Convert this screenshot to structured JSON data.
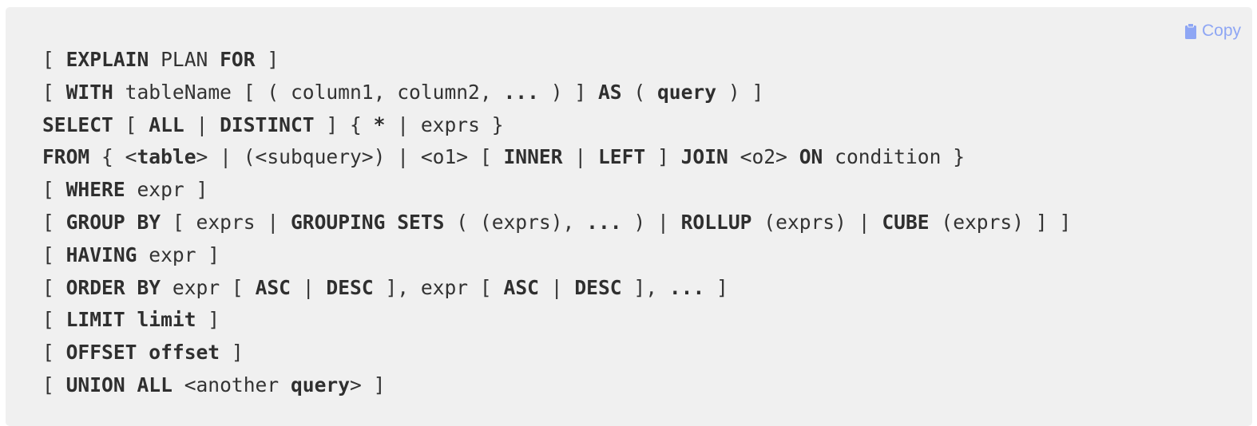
{
  "copy_button": {
    "label": "Copy",
    "icon": "clipboard-icon",
    "color": "#8ea6f4"
  },
  "code_lines": [
    [
      {
        "t": "[ ",
        "b": false
      },
      {
        "t": "EXPLAIN",
        "b": true
      },
      {
        "t": " PLAN ",
        "b": false
      },
      {
        "t": "FOR",
        "b": true
      },
      {
        "t": " ]",
        "b": false
      }
    ],
    [
      {
        "t": "[ ",
        "b": false
      },
      {
        "t": "WITH",
        "b": true
      },
      {
        "t": " tableName [ ( column1, column2, ",
        "b": false
      },
      {
        "t": "...",
        "b": true
      },
      {
        "t": " ) ] ",
        "b": false
      },
      {
        "t": "AS",
        "b": true
      },
      {
        "t": " ( ",
        "b": false
      },
      {
        "t": "query",
        "b": true
      },
      {
        "t": " ) ]",
        "b": false
      }
    ],
    [
      {
        "t": "SELECT",
        "b": true
      },
      {
        "t": " [ ",
        "b": false
      },
      {
        "t": "ALL",
        "b": true
      },
      {
        "t": " | ",
        "b": false
      },
      {
        "t": "DISTINCT",
        "b": true
      },
      {
        "t": " ] { ",
        "b": false
      },
      {
        "t": "*",
        "b": true
      },
      {
        "t": " | exprs }",
        "b": false
      }
    ],
    [
      {
        "t": "FROM",
        "b": true
      },
      {
        "t": " { <",
        "b": false
      },
      {
        "t": "table",
        "b": true
      },
      {
        "t": "> | (<subquery>) | <o1> [ ",
        "b": false
      },
      {
        "t": "INNER",
        "b": true
      },
      {
        "t": " | ",
        "b": false
      },
      {
        "t": "LEFT",
        "b": true
      },
      {
        "t": " ] ",
        "b": false
      },
      {
        "t": "JOIN",
        "b": true
      },
      {
        "t": " <o2> ",
        "b": false
      },
      {
        "t": "ON",
        "b": true
      },
      {
        "t": " condition }",
        "b": false
      }
    ],
    [
      {
        "t": "[ ",
        "b": false
      },
      {
        "t": "WHERE",
        "b": true
      },
      {
        "t": " expr ]",
        "b": false
      }
    ],
    [
      {
        "t": "[ ",
        "b": false
      },
      {
        "t": "GROUP BY",
        "b": true
      },
      {
        "t": " [ exprs | ",
        "b": false
      },
      {
        "t": "GROUPING SETS",
        "b": true
      },
      {
        "t": " ( (exprs), ",
        "b": false
      },
      {
        "t": "...",
        "b": true
      },
      {
        "t": " ) | ",
        "b": false
      },
      {
        "t": "ROLLUP",
        "b": true
      },
      {
        "t": " (exprs) | ",
        "b": false
      },
      {
        "t": "CUBE",
        "b": true
      },
      {
        "t": " (exprs) ] ]",
        "b": false
      }
    ],
    [
      {
        "t": "[ ",
        "b": false
      },
      {
        "t": "HAVING",
        "b": true
      },
      {
        "t": " expr ]",
        "b": false
      }
    ],
    [
      {
        "t": "[ ",
        "b": false
      },
      {
        "t": "ORDER BY",
        "b": true
      },
      {
        "t": " expr [ ",
        "b": false
      },
      {
        "t": "ASC",
        "b": true
      },
      {
        "t": " | ",
        "b": false
      },
      {
        "t": "DESC",
        "b": true
      },
      {
        "t": " ], expr [ ",
        "b": false
      },
      {
        "t": "ASC",
        "b": true
      },
      {
        "t": " | ",
        "b": false
      },
      {
        "t": "DESC",
        "b": true
      },
      {
        "t": " ], ",
        "b": false
      },
      {
        "t": "...",
        "b": true
      },
      {
        "t": " ]",
        "b": false
      }
    ],
    [
      {
        "t": "[ ",
        "b": false
      },
      {
        "t": "LIMIT limit",
        "b": true
      },
      {
        "t": " ]",
        "b": false
      }
    ],
    [
      {
        "t": "[ ",
        "b": false
      },
      {
        "t": "OFFSET offset",
        "b": true
      },
      {
        "t": " ]",
        "b": false
      }
    ],
    [
      {
        "t": "[ ",
        "b": false
      },
      {
        "t": "UNION ALL",
        "b": true
      },
      {
        "t": " <another ",
        "b": false
      },
      {
        "t": "query",
        "b": true
      },
      {
        "t": "> ]",
        "b": false
      }
    ]
  ]
}
